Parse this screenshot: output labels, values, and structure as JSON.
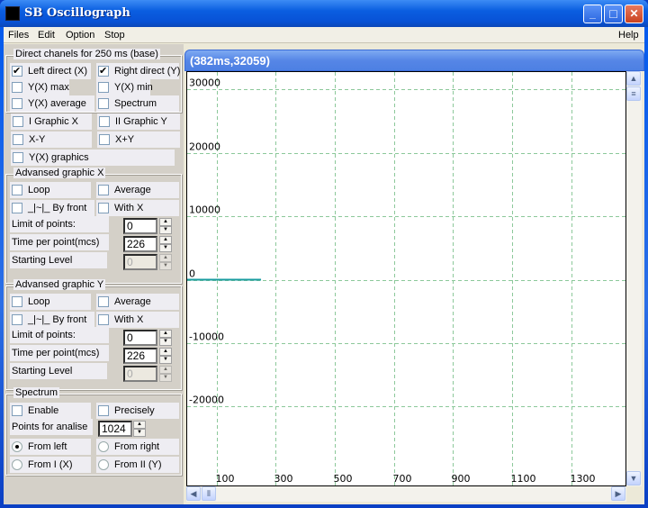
{
  "window": {
    "title": "SB Oscillograph",
    "minimize": "_",
    "maximize": "□",
    "close": "✕"
  },
  "menu": {
    "files": "Files",
    "edit": "Edit",
    "option": "Option",
    "stop": "Stop",
    "help": "Help"
  },
  "direct": {
    "legend": "Direct chanels for 250 ms (base)",
    "left_direct": {
      "label": "Left direct (X)",
      "checked": true
    },
    "right_direct": {
      "label": "Right direct (Y)",
      "checked": true
    },
    "yx_max": {
      "label": "Y(X) max",
      "checked": false
    },
    "yx_min": {
      "label": "Y(X) min",
      "checked": false
    },
    "yx_average": {
      "label": "Y(X) average",
      "checked": false
    },
    "spectrum": {
      "label": "Spectrum",
      "checked": false
    }
  },
  "graphics": {
    "i_graphic": "I Graphic X",
    "ii_graphic": "II Graphic Y",
    "x_minus_y": "X-Y",
    "x_plus_y": "X+Y",
    "yx_graphics": "Y(X) graphics"
  },
  "adv_x": {
    "legend": "Advansed graphic X",
    "loop": "Loop",
    "average": "Average",
    "by_front": "_|~|_ By front",
    "with_x": "With X",
    "limit_label": "Limit of points:",
    "limit_value": "0",
    "time_label": "Time per point(mcs)",
    "time_value": "226",
    "start_label": "Starting Level",
    "start_value": "0"
  },
  "adv_y": {
    "legend": "Advansed graphic Y",
    "loop": "Loop",
    "average": "Average",
    "by_front": "_|~|_ By front",
    "with_x": "With X",
    "limit_label": "Limit of points:",
    "limit_value": "0",
    "time_label": "Time per point(mcs)",
    "time_value": "226",
    "start_label": "Starting Level",
    "start_value": "0"
  },
  "spectrum": {
    "legend": "Spectrum",
    "enable": "Enable",
    "precisely": "Precisely",
    "points_label": "Points for analise",
    "points_value": "1024",
    "from_left": "From left",
    "from_right": "From right",
    "from_i": "From I (X)",
    "from_ii": "From II (Y)",
    "selected": "From left"
  },
  "graph_window": {
    "title": "(382ms,32059)"
  },
  "chart_data": {
    "type": "line",
    "xlim": [
      0,
      1490
    ],
    "ylim": [
      -32768,
      32768
    ],
    "x_ticks": [
      100,
      300,
      500,
      700,
      900,
      1100,
      1300
    ],
    "y_ticks": [
      30000,
      20000,
      10000,
      0,
      -10000,
      -20000
    ],
    "grid": true,
    "grid_color": "#8cc89a",
    "series": [
      {
        "color": "#1a9ca0",
        "x": [
          0,
          250
        ],
        "y": [
          0,
          0
        ]
      }
    ]
  }
}
